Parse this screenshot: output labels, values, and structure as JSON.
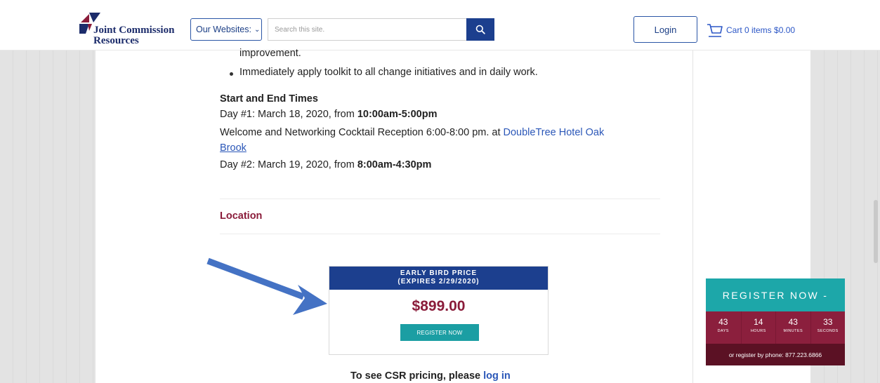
{
  "header": {
    "logo_line1": "Joint Commission",
    "logo_line2": "Resources",
    "websites_label": "Our Websites:",
    "search_placeholder": "Search this site.",
    "login_label": "Login",
    "cart_label": "Cart 0 items $0.00"
  },
  "content": {
    "improvement_text": "improvement.",
    "bullet_text": "Immediately apply toolkit to all change initiatives and in daily work.",
    "times_heading": "Start and End Times",
    "day1_prefix": "Day #1: March 18, 2020, from ",
    "day1_time": "10:00am-5:00pm",
    "reception_text": "Welcome and Networking Cocktail Reception 6:00-8:00 pm. at ",
    "hotel_link_line1": "DoubleTree Hotel Oak",
    "hotel_link_line2": "Brook",
    "day2_prefix": "Day #2: March 19, 2020, from ",
    "day2_time": "8:00am-4:30pm",
    "location_heading": "Location"
  },
  "price_box": {
    "title_line1": "EARLY BIRD PRICE",
    "title_line2": "(EXPIRES 2/29/2020)",
    "price": "$899.00",
    "register_label": "REGISTER NOW"
  },
  "csr": {
    "text": "To see CSR pricing, please ",
    "link": "log in"
  },
  "register_widget": {
    "title": "REGISTER NOW -",
    "countdown": [
      {
        "value": "43",
        "label": "DAYS"
      },
      {
        "value": "14",
        "label": "HOURS"
      },
      {
        "value": "43",
        "label": "MINUTES"
      },
      {
        "value": "33",
        "label": "SECONDS"
      }
    ],
    "phone_text": "or register by phone: 877.223.6866"
  },
  "colors": {
    "brand_blue": "#1c3f8e",
    "brand_maroon": "#8a1c3a",
    "teal": "#1da7a9",
    "arrow": "#4472c4",
    "link": "#2b57b8"
  },
  "icons": {
    "search": "search-icon",
    "cart": "cart-icon",
    "chevron": "chevron-down-icon",
    "annotation": "arrow-annotation"
  }
}
